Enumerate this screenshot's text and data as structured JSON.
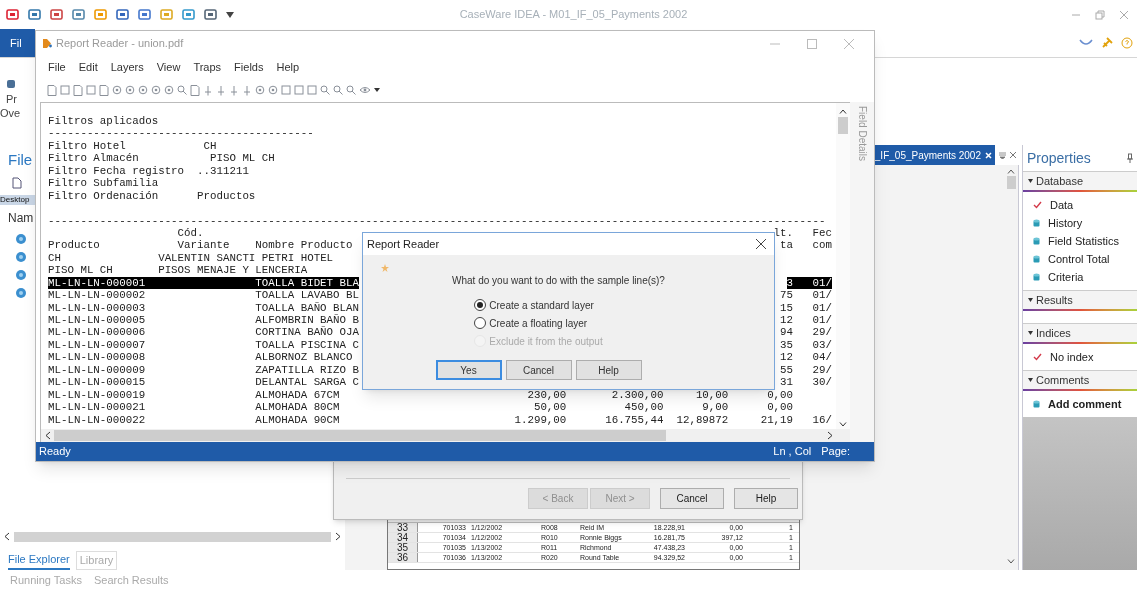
{
  "app": {
    "title": "CaseWare IDEA - M01_IF_05_Payments 2002",
    "file_tab": "Fil",
    "ribbon_labels": [
      "Pr",
      "Ove"
    ]
  },
  "explorer": {
    "title": "File",
    "location": "Desktop",
    "column": "Nam",
    "tabs": [
      {
        "label": "File Explorer",
        "selected": true
      },
      {
        "label": "Library",
        "selected": false
      }
    ]
  },
  "bottom_tabs": [
    "Running Tasks",
    "Search Results"
  ],
  "database_view": {
    "tab": "_IF_05_Payments 2002",
    "rows": [
      {
        "number": "33",
        "id": "701033",
        "date": "1/12/2002",
        "code": "R008",
        "name": "Reid IM",
        "amount": "18.228,91",
        "column_7": "0,00",
        "column_8": "1"
      },
      {
        "number": "34",
        "id": "701034",
        "date": "1/12/2002",
        "code": "R010",
        "name": "Ronnie Biggs",
        "amount": "16.281,75",
        "column_7": "397,12",
        "column_8": "1"
      },
      {
        "number": "35",
        "id": "701035",
        "date": "1/13/2002",
        "code": "R011",
        "name": "Richmond",
        "amount": "47.438,23",
        "column_7": "0,00",
        "column_8": "1"
      },
      {
        "number": "36",
        "id": "701036",
        "date": "1/13/2002",
        "code": "R020",
        "name": "Round Table",
        "amount": "94.329,52",
        "column_7": "0,00",
        "column_8": "1"
      }
    ]
  },
  "wizard": {
    "buttons": [
      {
        "label": "< Back",
        "disabled": true
      },
      {
        "label": "Next >",
        "disabled": true
      },
      {
        "label": "Cancel",
        "disabled": false
      },
      {
        "label": "Help",
        "disabled": false
      }
    ]
  },
  "report_reader": {
    "title": "Report Reader - union.pdf",
    "menu": [
      "File",
      "Edit",
      "Layers",
      "View",
      "Traps",
      "Fields",
      "Help"
    ],
    "side_tab": "Field Details",
    "filter_lines": [
      "Filtros aplicados",
      "-----------------------------------------",
      "Filtro Hotel            CH",
      "Filtro Almacén           PISO ML CH",
      "Filtro Fecha registro  ..311211",
      "Filtro Subfamilia",
      "Filtro Ordenación      Productos"
    ],
    "separator": "------------------------------------------------------------------------------------------------------------------------",
    "header_rows": [
      {
        "text": "                    Cód.",
        "column_6": "lt.",
        "column_7": "Fec"
      },
      {
        "text": "Producto            Variante    Nombre Producto",
        "column_6": "ta",
        "column_7": "com"
      },
      {
        "text": "CH               VALENTIN SANCTI PETRI HOTEL"
      },
      {
        "text": "PISO ML CH       PISOS MENAJE Y LENCERIA"
      }
    ],
    "rows": [
      {
        "code": "ML-LN-LN-000001",
        "name": "TOALLA BIDET BLA",
        "column_6": "3",
        "column_7": "01/",
        "selected": true
      },
      {
        "code": "ML-LN-LN-000002",
        "name": "TOALLA LAVABO BL",
        "column_6": "75",
        "column_7": "01/",
        "selected": false
      },
      {
        "code": "ML-LN-LN-000003",
        "name": "TOALLA BAÑO BLAN",
        "column_6": "15",
        "column_7": "01/",
        "selected": false
      },
      {
        "code": "ML-LN-LN-000005",
        "name": "ALFOMBRIN BAÑO B",
        "column_6": "12",
        "column_7": "01/",
        "selected": false
      },
      {
        "code": "ML-LN-LN-000006",
        "name": "CORTINA BAÑO OJA",
        "column_6": "94",
        "column_7": "29/",
        "selected": false
      },
      {
        "code": "ML-LN-LN-000007",
        "name": "TOALLA PISCINA C",
        "column_6": "35",
        "column_7": "03/",
        "selected": false
      },
      {
        "code": "ML-LN-LN-000008",
        "name": "ALBORNOZ BLANCO",
        "column_6": "12",
        "column_7": "04/",
        "selected": false
      },
      {
        "code": "ML-LN-LN-000009",
        "name": "ZAPATILLA RIZO B",
        "column_6": "55",
        "column_7": "29/",
        "selected": false
      },
      {
        "code": "ML-LN-LN-000015",
        "name": "DELANTAL SARGA C",
        "column_6": "31",
        "column_7": "30/",
        "selected": false
      },
      {
        "code": "ML-LN-LN-000019",
        "name": "ALMOHADA 67CM",
        "column_3": "230,00",
        "column_4": "2.300,00",
        "column_5": "10,00",
        "column_6": "0,00",
        "selected": false
      },
      {
        "code": "ML-LN-LN-000021",
        "name": "ALMOHADA 80CM",
        "column_3": "50,00",
        "column_4": "450,00",
        "column_5": "9,00",
        "column_6": "0,00",
        "selected": false
      },
      {
        "code": "ML-LN-LN-000022",
        "name": "ALMOHADA 90CM",
        "column_3": "1.299,00",
        "column_4": "16.755,44",
        "column_5": "12,89872",
        "column_6": "21,19",
        "column_7": "16/",
        "selected": false
      }
    ],
    "status": "Ready",
    "position": "Ln , Col",
    "page": "Page:"
  },
  "dialog": {
    "title": "Report Reader",
    "question": "What do you want to do with the sample line(s)?",
    "options": [
      {
        "label": "Create a standard layer",
        "selected": true,
        "disabled": false
      },
      {
        "label": "Create a floating layer",
        "selected": false,
        "disabled": false
      },
      {
        "label": "Exclude it from the output",
        "selected": false,
        "disabled": true
      }
    ],
    "buttons": [
      {
        "label": "Yes",
        "default": true
      },
      {
        "label": "Cancel",
        "default": false
      },
      {
        "label": "Help",
        "default": false
      }
    ]
  },
  "properties": {
    "title": "Properties",
    "sections": [
      {
        "title": "Database",
        "items": [
          {
            "label": "Data",
            "kind": "check"
          },
          {
            "label": "History",
            "kind": "link"
          },
          {
            "label": "Field Statistics",
            "kind": "link"
          },
          {
            "label": "Control Total",
            "kind": "link"
          },
          {
            "label": "Criteria",
            "kind": "link"
          }
        ]
      },
      {
        "title": "Results"
      },
      {
        "title": "Indices",
        "items": [
          {
            "label": "No index",
            "kind": "check"
          }
        ]
      },
      {
        "title": "Comments",
        "items": [
          {
            "label": "Add comment",
            "kind": "action"
          }
        ]
      }
    ]
  }
}
